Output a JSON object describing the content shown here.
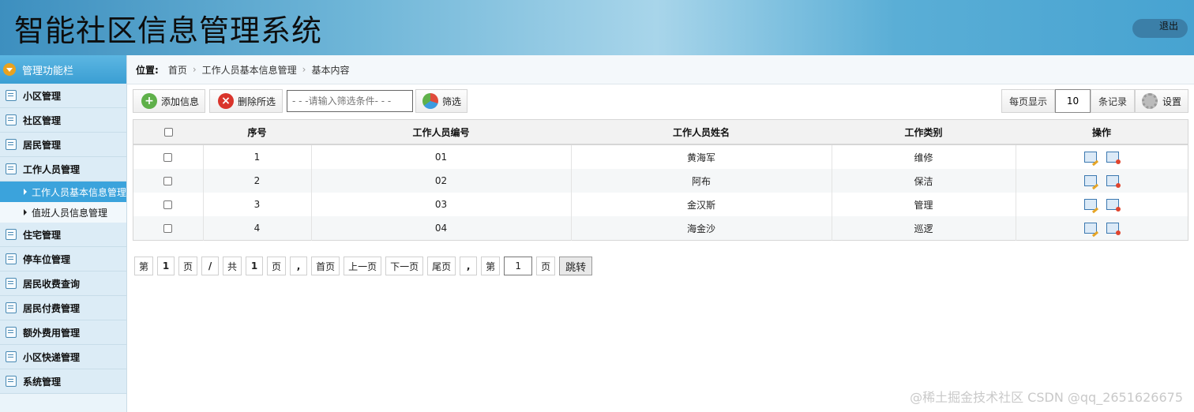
{
  "app": {
    "title": "智能社区信息管理系统",
    "logout": "退出"
  },
  "sidebar": {
    "header": "管理功能栏",
    "items": [
      {
        "label": "小区管理"
      },
      {
        "label": "社区管理"
      },
      {
        "label": "居民管理"
      },
      {
        "label": "工作人员管理"
      }
    ],
    "subitems": [
      {
        "label": "工作人员基本信息管理",
        "active": true
      },
      {
        "label": "值班人员信息管理",
        "active": false
      }
    ],
    "items2": [
      {
        "label": "住宅管理"
      },
      {
        "label": "停车位管理"
      },
      {
        "label": "居民收费查询"
      },
      {
        "label": "居民付费管理"
      },
      {
        "label": "额外费用管理"
      },
      {
        "label": "小区快递管理"
      },
      {
        "label": "系统管理"
      }
    ]
  },
  "breadcrumb": {
    "label": "位置:",
    "items": [
      "首页",
      "工作人员基本信息管理",
      "基本内容"
    ]
  },
  "toolbar": {
    "add": "添加信息",
    "delete": "删除所选",
    "search_placeholder": "- - -请输入筛选条件- - -",
    "filter": "筛选",
    "per_page_label": "每页显示",
    "per_page_value": "10",
    "records_label": "条记录",
    "settings": "设置"
  },
  "table": {
    "headers": [
      "序号",
      "工作人员编号",
      "工作人员姓名",
      "工作类别",
      "操作"
    ],
    "rows": [
      {
        "no": "1",
        "id": "01",
        "name": "黄海军",
        "type": "维修"
      },
      {
        "no": "2",
        "id": "02",
        "name": "阿布",
        "type": "保洁"
      },
      {
        "no": "3",
        "id": "03",
        "name": "金汉斯",
        "type": "管理"
      },
      {
        "no": "4",
        "id": "04",
        "name": "海金沙",
        "type": "巡逻"
      }
    ]
  },
  "pager": {
    "di": "第",
    "page_current": "1",
    "ye": "页",
    "slash": "/",
    "gong": "共",
    "page_total": "1",
    "ye2": "页",
    "comma": ",",
    "first": "首页",
    "prev": "上一页",
    "next": "下一页",
    "last": "尾页",
    "comma2": ",",
    "di2": "第",
    "jump_value": "1",
    "ye3": "页",
    "go": "跳转"
  },
  "watermark": "@稀土掘金技术社区 CSDN @qq_2651626675",
  "colors": {
    "accent": "#3ba3dc",
    "header_bg": "#6fb6d8"
  }
}
